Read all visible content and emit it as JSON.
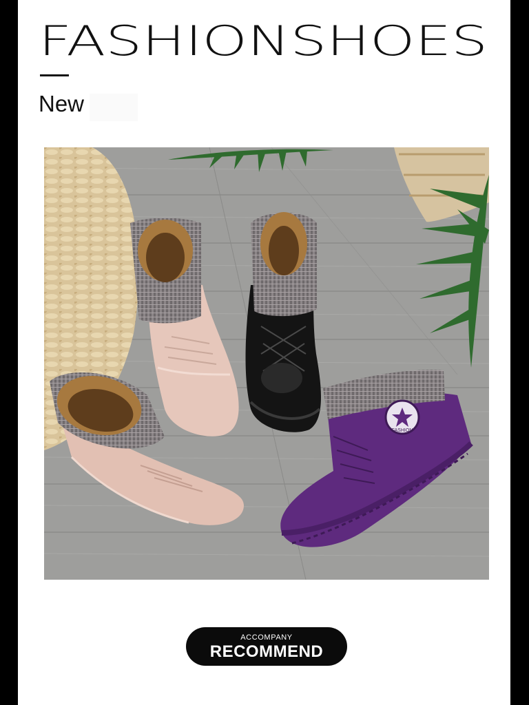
{
  "header": {
    "brand_title": "FASHIONSHOES",
    "subtitle": "New"
  },
  "product_photo": {
    "boots": [
      {
        "color_name": "nude-pink",
        "color": "#e3bfb2"
      },
      {
        "color_name": "black",
        "color": "#121212"
      },
      {
        "color_name": "purple",
        "color": "#5e2a7e"
      }
    ],
    "badge_text": "FASHION"
  },
  "recommend_badge": {
    "top_label": "ACCOMPANY",
    "main_label": "RECOMMEND"
  },
  "colors": {
    "page_background": "#ffffff",
    "side_bars": "#000000",
    "floor": "#9a9a98",
    "badge_background": "#0b0b0b"
  }
}
